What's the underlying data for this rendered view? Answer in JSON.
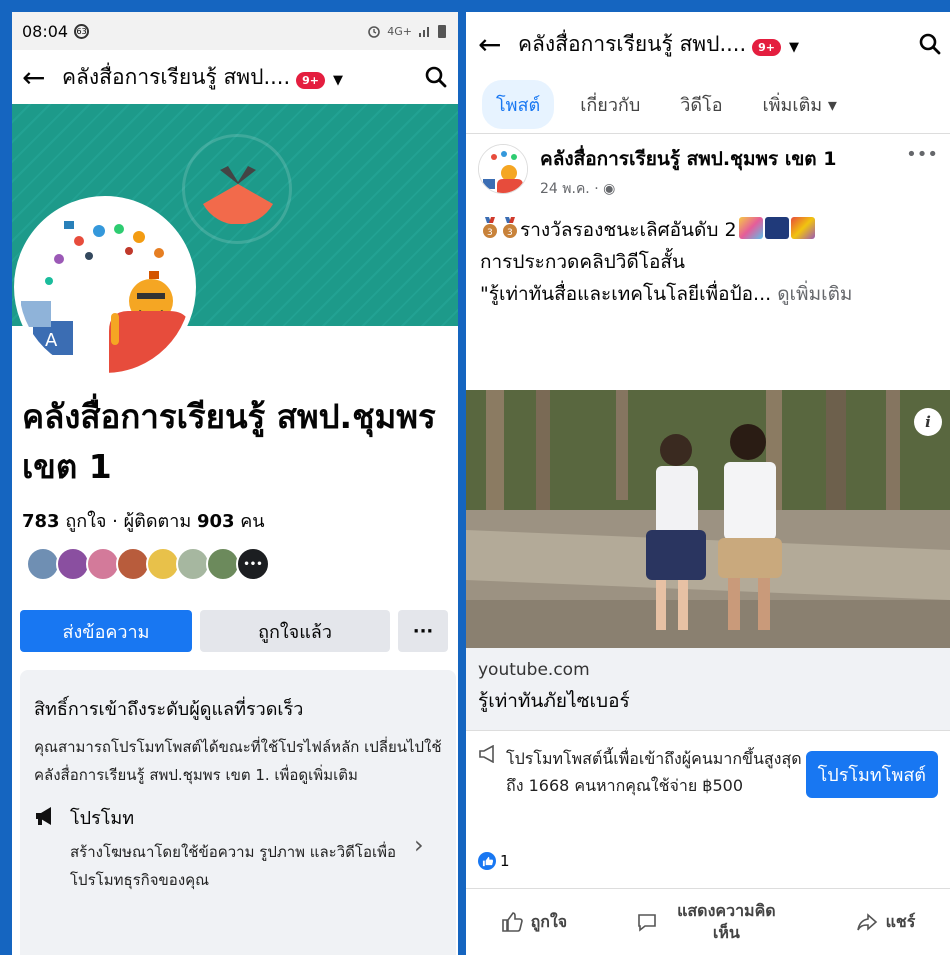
{
  "left": {
    "statusbar": {
      "time": "08:04",
      "notif_count": "63",
      "signal": "4G+"
    },
    "header": {
      "title": "คลังสื่อการเรียนรู้ สพป....",
      "badge": "9+"
    },
    "page_name": "คลังสื่อการเรียนรู้ สพป.ชุมพร เขต 1",
    "stats": {
      "likes_count": "783",
      "likes_label": "ถูกใจ",
      "sep": " · ",
      "followers_label": "ผู้ติดตาม",
      "followers_count": "903",
      "followers_unit": "คน"
    },
    "friend_colors": [
      "#6f8fb3",
      "#8a4fa0",
      "#d37a9a",
      "#b85c3c",
      "#e8c14a",
      "#a6b7a0",
      "#6c8a5c"
    ],
    "buttons": {
      "message": "ส่งข้อความ",
      "liked": "ถูกใจแล้ว",
      "more": "···"
    },
    "admin": {
      "title": "สิทธิ์การเข้าถึงระดับผู้ดูแลที่รวดเร็ว",
      "desc": "คุณสามารถโปรโมทโพสต์ได้ขณะที่ใช้โปรไฟล์หลัก เปลี่ยนไปใช้ คลังสื่อการเรียนรู้ สพป.ชุมพร เขต 1. เพื่อดูเพิ่มเติม",
      "promo_title": "โปรโมท",
      "promo_text": "สร้างโฆษณาโดยใช้ข้อความ รูปภาพ และวิดีโอเพื่อโปรโมทธุรกิจของคุณ"
    }
  },
  "right": {
    "header": {
      "title": "คลังสื่อการเรียนรู้ สพป....",
      "badge": "9+"
    },
    "tabs": [
      {
        "label": "โพสต์",
        "active": true
      },
      {
        "label": "เกี่ยวกับ",
        "active": false
      },
      {
        "label": "วิดีโอ",
        "active": false
      },
      {
        "label": "เพิ่มเติม ▾",
        "active": false
      }
    ],
    "post": {
      "author": "คลังสื่อการเรียนรู้ สพป.ชุมพร เขต 1",
      "date": "24 พ.ค. · ",
      "line1": "รางวัลรองชนะเลิศอันดับ 2",
      "line2": "การประกวดคลิปวิดีโอสั้น",
      "line3": "\"รู้เท่าทันสื่อและเทคโนโลยีเพื่อป้อ... ",
      "see_more": "ดูเพิ่มเติม",
      "link_domain": "youtube.com",
      "link_title": "รู้เท่าทันภัยไซเบอร์",
      "promo_text": "โปรโมทโพสต์นี้เพื่อเข้าถึงผู้คนมากขึ้นสูงสุดถึง 1668 คนหากคุณใช้จ่าย ฿500",
      "promo_button": "โปรโมทโพสต์",
      "reaction_count": "1",
      "actions": {
        "like": "ถูกใจ",
        "comment": "แสดงความคิดเห็น",
        "share": "แชร์"
      }
    }
  },
  "colors": {
    "brand_blue": "#1877f2",
    "frame_blue": "#1565c0",
    "cover_teal": "#1d9a8a",
    "badge_red": "#e41e3f"
  }
}
